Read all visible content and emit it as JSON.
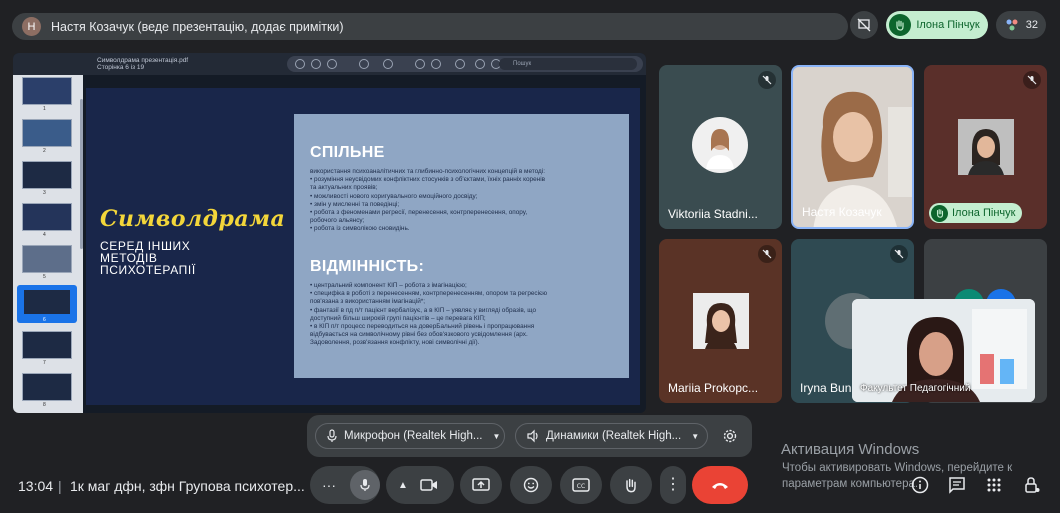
{
  "top_bar": {
    "presenter_initial": "Н",
    "presenter_text": "Настя Козачук (веде презентацію, додає примітки)",
    "hand_raised_name": "Ілона Пінчук",
    "participants_count": "32"
  },
  "presentation": {
    "file_title": "Символдрама презентація.pdf",
    "page_info": "Сторінка 6 із 19",
    "search_placeholder": "Пошук",
    "thumbnail_numbers": [
      "1",
      "2",
      "3",
      "4",
      "5",
      "6",
      "7",
      "8"
    ],
    "active_thumbnail": 6,
    "slide": {
      "script_title": "Символдрама",
      "subtitle": "СЕРЕД ІНШИХ МЕТОДІВ ПСИХОТЕРАПІЇ",
      "heading_common": "СПІЛЬНЕ",
      "common_lines": [
        "використання психоаналітичних та глибинно-психологічних концепцій в методі:",
        "• розуміння неусвідомих конфліктних стосунків з об'єктами, їхніх ранніх коренів",
        "та актуальних проявів;",
        "• можливості нового коригувального емоційного досвіду;",
        "• змін у мисленні та поведінці;",
        "• робота з феноменами регресії, перенесення, контрперенесення, опору,",
        "робочого альянсу;",
        "• робота із символікою сновидінь."
      ],
      "heading_diff": "ВІДМІННІСТЬ:",
      "diff_lines": [
        "• центральний компонент КІП – робота з імагінацією;",
        "• специфіка в роботі з перенесенням, контрперенесенням, опором та регресією",
        "пов'язана з використанням імагінацій*;",
        "• фантазії в пд п/т пацієнт вербалізує, а в КІП – уявляє у вигляді образів, що",
        "доступний більш широкій групі пацієнтів – це перевага КІП;",
        "• в КІП п/т процесс переводиться на доверБальний рівень і пропрацювання",
        "відбувається на символічному рівні без обов'язкового усвідомлення (арх.",
        "Задоволення, розв'язання конфлікту, нові символічні дії)."
      ]
    }
  },
  "participants": [
    {
      "name": "Viktoriia Stadni...",
      "muted": true,
      "bg": "#3a4c50",
      "avatar_bg": "#f0f0f0"
    },
    {
      "name": "Настя Козачук",
      "muted": false,
      "speaking": true,
      "bg": "#cfc7c0"
    },
    {
      "name": "Ілона Пінчук",
      "muted": true,
      "hand_raised": true,
      "bg": "#5a2f2a",
      "avatar_bg": "#cfcfcf"
    },
    {
      "name": "Mariia Prokopc...",
      "muted": true,
      "bg": "#5a3326",
      "avatar_bg": "#e8e8e8"
    },
    {
      "name": "Iryna Bun",
      "muted": true,
      "bg": "#2f4a52"
    },
    {
      "name": "",
      "muted": false,
      "bg": "#3c4043"
    }
  ],
  "self_view": {
    "name": "Факультет Педагогічний"
  },
  "audio": {
    "microphone_label": "Микрофон (Realtek High...",
    "speaker_label": "Динамики (Realtek High..."
  },
  "bottom_bar": {
    "time": "13:04",
    "separator": "|",
    "meeting_name": "1к маг дфн, зфн Групова психотер..."
  },
  "activation": {
    "title": "Активация Windows",
    "subtitle": "Чтобы активировать Windows, перейдите к параметрам компьютера."
  },
  "colors": {
    "background": "#202124",
    "panel": "#3c4043",
    "end_call": "#ea4335",
    "hand_green": "#c4eed0",
    "accent_blue": "#1a73e8"
  }
}
